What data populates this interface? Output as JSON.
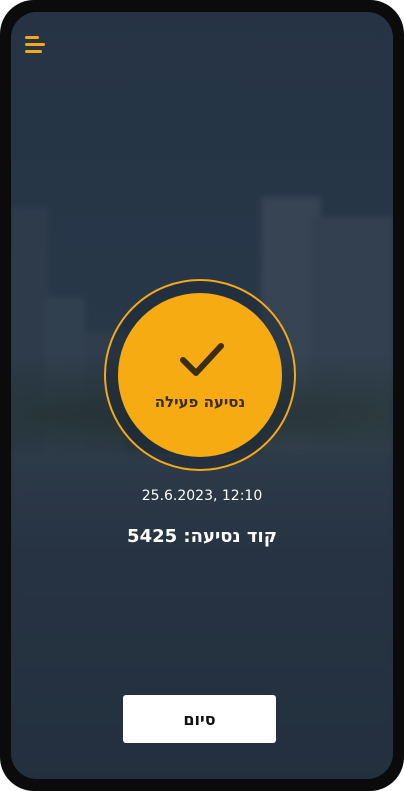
{
  "menu": {
    "icon": "hamburger-menu-icon",
    "color": "#f5a917"
  },
  "status": {
    "icon": "checkmark-icon",
    "label": "נסיעה פעילה",
    "accent": "#f6ab12"
  },
  "ride": {
    "datetime": "25.6.2023, 12:10",
    "code_text": "קוד נסיעה: 5425"
  },
  "actions": {
    "finish_label": "סיום"
  }
}
